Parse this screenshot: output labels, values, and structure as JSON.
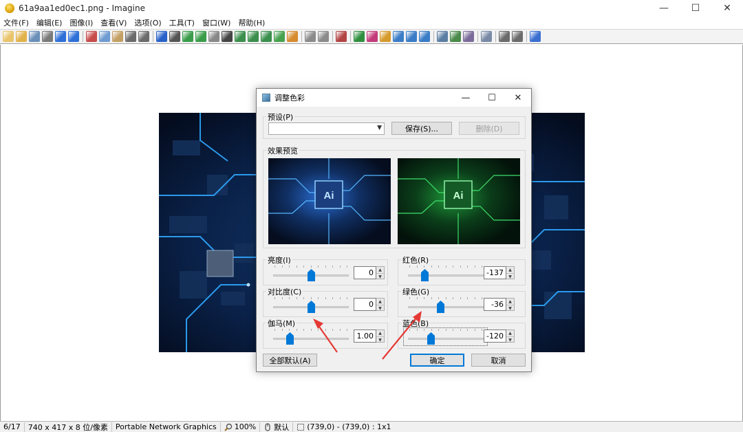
{
  "window": {
    "title": "61a9aa1ed0ec1.png - Imagine",
    "minimize": "—",
    "maximize": "☐",
    "close": "✕"
  },
  "menu": [
    "文件(F)",
    "编辑(E)",
    "图像(I)",
    "查看(V)",
    "选项(O)",
    "工具(T)",
    "窗口(W)",
    "帮助(H)"
  ],
  "toolbar": {
    "icons": [
      {
        "name": "new-icon",
        "color": "#e9c46a"
      },
      {
        "name": "open-icon",
        "color": "#e2b24a"
      },
      {
        "name": "save-icon",
        "color": "#6a8fb8"
      },
      {
        "name": "print-icon",
        "color": "#7a7a7a"
      },
      {
        "name": "prev-icon",
        "color": "#2e6fd8"
      },
      {
        "name": "next-icon",
        "color": "#2e6fd8"
      },
      {
        "name": "sep"
      },
      {
        "name": "cut-icon",
        "color": "#c84b4b"
      },
      {
        "name": "copy-icon",
        "color": "#6e9bd1"
      },
      {
        "name": "paste-icon",
        "color": "#c4a064"
      },
      {
        "name": "undo-icon",
        "color": "#6b6b6b"
      },
      {
        "name": "redo-icon",
        "color": "#6b6b6b"
      },
      {
        "name": "sep"
      },
      {
        "name": "info-icon",
        "color": "#2a62c9"
      },
      {
        "name": "camera-icon",
        "color": "#555555"
      },
      {
        "name": "resize-icon",
        "color": "#3a9c4a"
      },
      {
        "name": "canvas-icon",
        "color": "#3a9c4a"
      },
      {
        "name": "gray-icon",
        "color": "#888888"
      },
      {
        "name": "negative-icon",
        "color": "#444444"
      },
      {
        "name": "effect-icon",
        "color": "#3b8f4d"
      },
      {
        "name": "rotate-icon",
        "color": "#3b8f4d"
      },
      {
        "name": "flip-icon",
        "color": "#3b8f4d"
      },
      {
        "name": "color-icon",
        "color": "#47a14e"
      },
      {
        "name": "palette-icon",
        "color": "#d68b2e"
      },
      {
        "name": "sep"
      },
      {
        "name": "zoom-in-icon",
        "color": "#8b8b8b"
      },
      {
        "name": "zoom-out-icon",
        "color": "#8b8b8b"
      },
      {
        "name": "sep"
      },
      {
        "name": "crop-icon",
        "color": "#b34444"
      },
      {
        "name": "sep"
      },
      {
        "name": "zoom-fit-icon",
        "color": "#2f8f3f"
      },
      {
        "name": "zoom-100-icon",
        "color": "#c43b7a"
      },
      {
        "name": "zoom-actual-icon",
        "color": "#d69a2b"
      },
      {
        "name": "view1-icon",
        "color": "#3a7cc6"
      },
      {
        "name": "view2-icon",
        "color": "#3a7cc6"
      },
      {
        "name": "view3-icon",
        "color": "#3a7cc6"
      },
      {
        "name": "sep"
      },
      {
        "name": "slideshow-icon",
        "color": "#5b7ea3"
      },
      {
        "name": "thumbnail-icon",
        "color": "#4a8a4a"
      },
      {
        "name": "batch-icon",
        "color": "#7b6b9a"
      },
      {
        "name": "sep"
      },
      {
        "name": "tools-icon",
        "color": "#7a8aa6"
      },
      {
        "name": "sep"
      },
      {
        "name": "plugin-icon",
        "color": "#6b6b6b"
      },
      {
        "name": "settings-icon",
        "color": "#6b6b6b"
      },
      {
        "name": "sep"
      },
      {
        "name": "help-icon",
        "color": "#3a6fd1"
      }
    ]
  },
  "status": {
    "index": "6/17",
    "dimensions": "740 x 417 x 8 位/像素",
    "format": "Portable Network Graphics",
    "zoom": "100%",
    "mode": "默认",
    "coords": "(739,0) - (739,0) : 1x1"
  },
  "dialog": {
    "title": "调整色彩",
    "minimize": "—",
    "maximize": "☐",
    "close": "✕",
    "preset_label": "预设(P)",
    "preset_value": "",
    "save_button": "保存(S)...",
    "delete_button": "删除(D)",
    "preview_label": "效果预览",
    "brightness_label": "亮度(I)",
    "brightness_value": "0",
    "contrast_label": "对比度(C)",
    "contrast_value": "0",
    "gamma_label": "伽马(M)",
    "gamma_value": "1.00",
    "red_label": "红色(R)",
    "red_value": "-137",
    "green_label": "绿色(G)",
    "green_value": "-36",
    "blue_label": "蓝色(B)",
    "blue_value": "-120",
    "reset_button": "全部默认(A)",
    "ok_button": "确定",
    "cancel_button": "取消",
    "preview_chip_text": "Ai",
    "sliders": {
      "brightness": 0.5,
      "contrast": 0.5,
      "gamma": 0.22,
      "red": 0.22,
      "green": 0.43,
      "blue": 0.3
    }
  }
}
